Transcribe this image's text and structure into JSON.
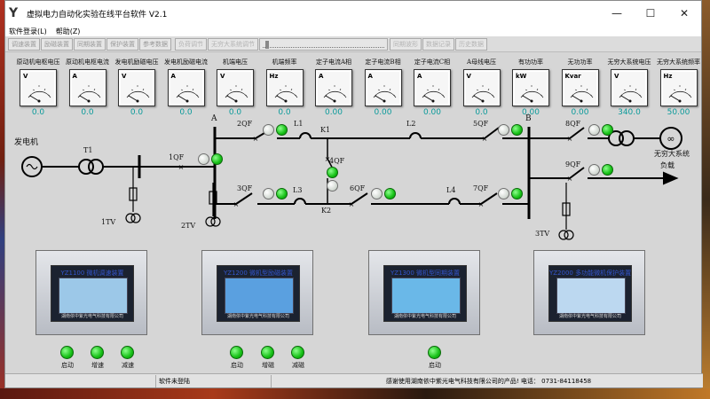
{
  "window": {
    "title": "虚拟电力自动化实验在线平台软件 V2.1",
    "logo_glyph": "Y",
    "min_glyph": "—",
    "max_glyph": "☐",
    "close_glyph": "✕"
  },
  "menu": {
    "items": [
      "软件登录(L)",
      "帮助(Z)"
    ]
  },
  "toolbar": {
    "buttons_left": [
      "调速装置",
      "励磁装置",
      "同期装置",
      "保护装置",
      "参考数据"
    ],
    "buttons_mid": [
      "负荷调节",
      "无穷大系统调节"
    ],
    "buttons_right": [
      "同期波形",
      "数据记录",
      "历史数据"
    ]
  },
  "meters": [
    {
      "label": "原动机电枢电压",
      "unit": "V",
      "value": "0.0"
    },
    {
      "label": "原动机电枢电流",
      "unit": "A",
      "value": "0.0"
    },
    {
      "label": "发电机励磁电压",
      "unit": "V",
      "value": "0.0"
    },
    {
      "label": "发电机励磁电流",
      "unit": "A",
      "value": "0.0"
    },
    {
      "label": "机端电压",
      "unit": "V",
      "value": "0.0"
    },
    {
      "label": "机端频率",
      "unit": "Hz",
      "value": "0.0"
    },
    {
      "label": "定子电流A相",
      "unit": "A",
      "value": "0.00"
    },
    {
      "label": "定子电流B相",
      "unit": "A",
      "value": "0.00"
    },
    {
      "label": "定子电流C相",
      "unit": "A",
      "value": "0.00"
    },
    {
      "label": "A母线电压",
      "unit": "V",
      "value": "0.0"
    },
    {
      "label": "有功功率",
      "unit": "kW",
      "value": "0.00"
    },
    {
      "label": "无功功率",
      "unit": "Kvar",
      "value": "0.00"
    },
    {
      "label": "无穷大系统电压",
      "unit": "V",
      "value": "340.0"
    },
    {
      "label": "无穷大系统频率",
      "unit": "Hz",
      "value": "50.00"
    }
  ],
  "diagram": {
    "generator": "发电机",
    "t1": "T1",
    "qf1": "1QF",
    "bus_a": "A",
    "bus_b": "B",
    "qf2": "2QF",
    "l1": "L1",
    "k1": "K1",
    "l2": "L2",
    "qf5": "5QF",
    "qf4": "4QF",
    "qf3": "3QF",
    "l3": "L3",
    "k2": "K2",
    "qf6": "6QF",
    "l4": "L4",
    "qf7": "7QF",
    "qf8": "8QF",
    "qf9": "9QF",
    "infinite_system": "无穷大系统",
    "load": "负载",
    "tv1": "1TV",
    "tv2": "2TV",
    "tv3": "3TV",
    "lamps": {
      "qf1": [
        "off",
        "on"
      ],
      "qf2": [
        "off",
        "on"
      ],
      "qf5": [
        "off",
        "on"
      ],
      "qf4": [
        "on",
        "off"
      ],
      "qf3": [
        "off",
        "on"
      ],
      "qf6": [
        "off",
        "on"
      ],
      "qf7": [
        "off",
        "on"
      ],
      "qf8": [
        "off",
        "on"
      ],
      "qf9": [
        "off",
        "on"
      ]
    }
  },
  "devices": [
    {
      "title": "YZ1100 微机调速装置",
      "maker": "湖南依中紫光电气科技有限公司",
      "lcd": "#9cc8e8"
    },
    {
      "title": "YZ1200 微机型励磁装置",
      "maker": "湖南依中紫光电气科技有限公司",
      "lcd": "#5aa0e0"
    },
    {
      "title": "YZ1300 微机型同期装置",
      "maker": "湖南依中紫光电气科技有限公司",
      "lcd": "#6ab8e8"
    },
    {
      "title": "YZ2000 多功能微机保护装置",
      "maker": "湖南依中紫光电气科技有限公司",
      "lcd": "#bcd8f0"
    }
  ],
  "controls": {
    "governor": [
      "启动",
      "增速",
      "减速"
    ],
    "exciter": [
      "启动",
      "增磁",
      "减磁"
    ],
    "sync": [
      "启动"
    ]
  },
  "status": {
    "login": "软件未登陆",
    "message": "感谢使用湖南依中紫光电气科技有限公司的产品! 电话： 0731-84118458"
  },
  "colors": {
    "lamp_on": "#16c016",
    "meter_value": "#0a9a9a",
    "device_title": "#3355cc"
  }
}
